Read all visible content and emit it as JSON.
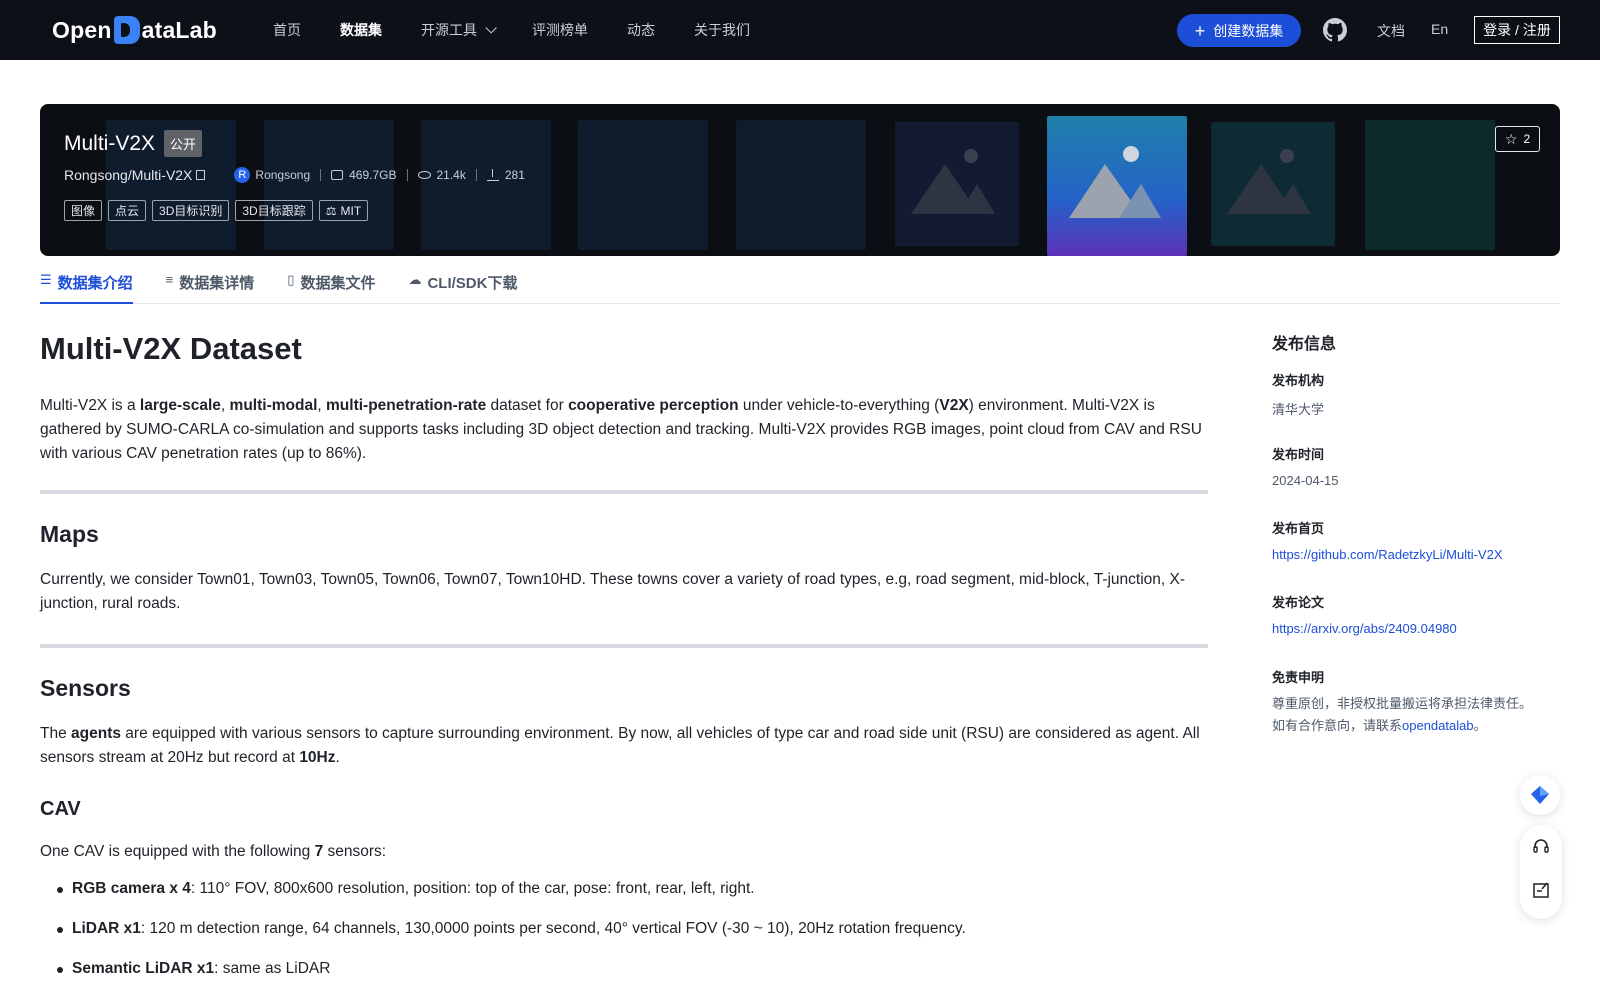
{
  "nav": {
    "logo_left": "Open",
    "logo_right": "ataLab",
    "links": [
      "首页",
      "数据集",
      "开源工具",
      "评测榜单",
      "动态",
      "关于我们"
    ],
    "create_label": "创建数据集",
    "docs": "文档",
    "lang": "En",
    "login": "登录 / 注册"
  },
  "banner": {
    "title": "Multi-V2X",
    "visibility": "公开",
    "repo": "Rongsong/Multi-V2X",
    "avatar_letter": "R",
    "owner": "Rongsong",
    "size": "469.7GB",
    "views": "21.4k",
    "downloads": "281",
    "tags": [
      "图像",
      "点云",
      "3D目标识别",
      "3D目标跟踪"
    ],
    "license": "MIT",
    "stars": "2"
  },
  "tabs": [
    "数据集介绍",
    "数据集详情",
    "数据集文件",
    "CLI/SDK下载"
  ],
  "content": {
    "title": "Multi-V2X Dataset",
    "intro": {
      "t1": "Multi-V2X is a ",
      "b1": "large-scale",
      "t2": ", ",
      "b2": "multi-modal",
      "t3": ", ",
      "b3": "multi-penetration-rate",
      "t4": " dataset for ",
      "b4": "cooperative perception",
      "t5": " under vehicle-to-everything (",
      "b5": "V2X",
      "t6": ") environment. Multi-V2X is gathered by SUMO-CARLA co-simulation and supports tasks including 3D object detection and tracking. Multi-V2X provides RGB images, point cloud from CAV and RSU with various CAV penetration rates (up to 86%)."
    },
    "maps_heading": "Maps",
    "maps_text": "Currently, we consider Town01, Town03, Town05, Town06, Town07, Town10HD. These towns cover a variety of road types, e.g, road segment, mid-block, T-junction, X-junction, rural roads.",
    "sensors_heading": "Sensors",
    "sensors": {
      "t1": "The ",
      "b1": "agents",
      "t2": " are equipped with various sensors to capture surrounding environment. By now, all vehicles of type car and road side unit (RSU) are considered as agent. All sensors stream at 20Hz but record at ",
      "b2": "10Hz",
      "t3": "."
    },
    "cav_heading": "CAV",
    "cav_intro": {
      "t1": "One CAV is equipped with the following ",
      "b1": "7",
      "t2": " sensors:"
    },
    "cav_items": [
      {
        "b": "RGB camera x 4",
        "t": ": 110° FOV, 800x600 resolution, position: top of the car, pose: front, rear, left, right."
      },
      {
        "b": "LiDAR x1",
        "t": ": 120 m detection range, 64 channels, 130,0000 points per second, 40° vertical FOV (-30 ~ 10), 20Hz rotation frequency."
      },
      {
        "b": "Semantic LiDAR x1",
        "t": ": same as LiDAR"
      }
    ]
  },
  "sidebar": {
    "heading": "发布信息",
    "org_label": "发布机构",
    "org": "清华大学",
    "date_label": "发布时间",
    "date": "2024-04-15",
    "home_label": "发布首页",
    "home": "https://github.com/RadetzkyLi/Multi-V2X",
    "paper_label": "发布论文",
    "paper": "https://arxiv.org/abs/2409.04980",
    "disclaimer_label": "免责申明",
    "disclaimer_1": "尊重原创，非授权批量搬运将承担法律责任。",
    "disclaimer_2": "如有合作意向，请联系",
    "disclaimer_link": "opendatalab",
    "disclaimer_end": "。"
  },
  "colors": {
    "nav_bg": "#0d1117",
    "accent": "#1d4ed8",
    "banner_bg": "#0b0f14"
  }
}
